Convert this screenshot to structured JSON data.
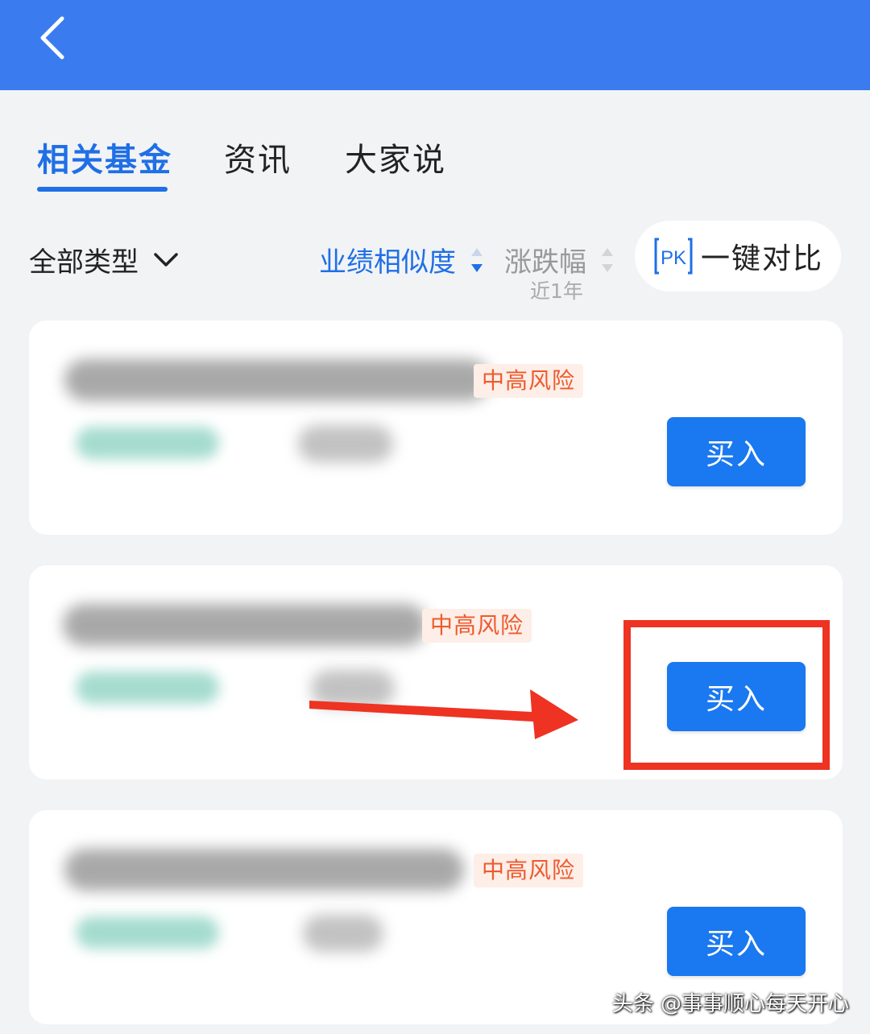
{
  "tabs": [
    {
      "label": "相关基金",
      "active": true
    },
    {
      "label": "资讯",
      "active": false
    },
    {
      "label": "大家说",
      "active": false
    }
  ],
  "filters": {
    "type_label": "全部类型",
    "sort_similarity_label": "业绩相似度",
    "sort_change_label": "涨跌幅",
    "sort_change_period": "近1年",
    "compare_icon_text": "PK",
    "compare_label": "一键对比"
  },
  "funds": [
    {
      "risk_label": "中高风险",
      "buy_label": "买入"
    },
    {
      "risk_label": "中高风险",
      "buy_label": "买入"
    },
    {
      "risk_label": "中高风险",
      "buy_label": "买入"
    }
  ],
  "watermark": "头条 @事事顺心每天开心",
  "colors": {
    "header": "#3a7cf0",
    "accent": "#1f6fe6",
    "buy_button": "#1a78f0",
    "risk_text": "#ef5a2d",
    "annotation": "#ee3322"
  }
}
